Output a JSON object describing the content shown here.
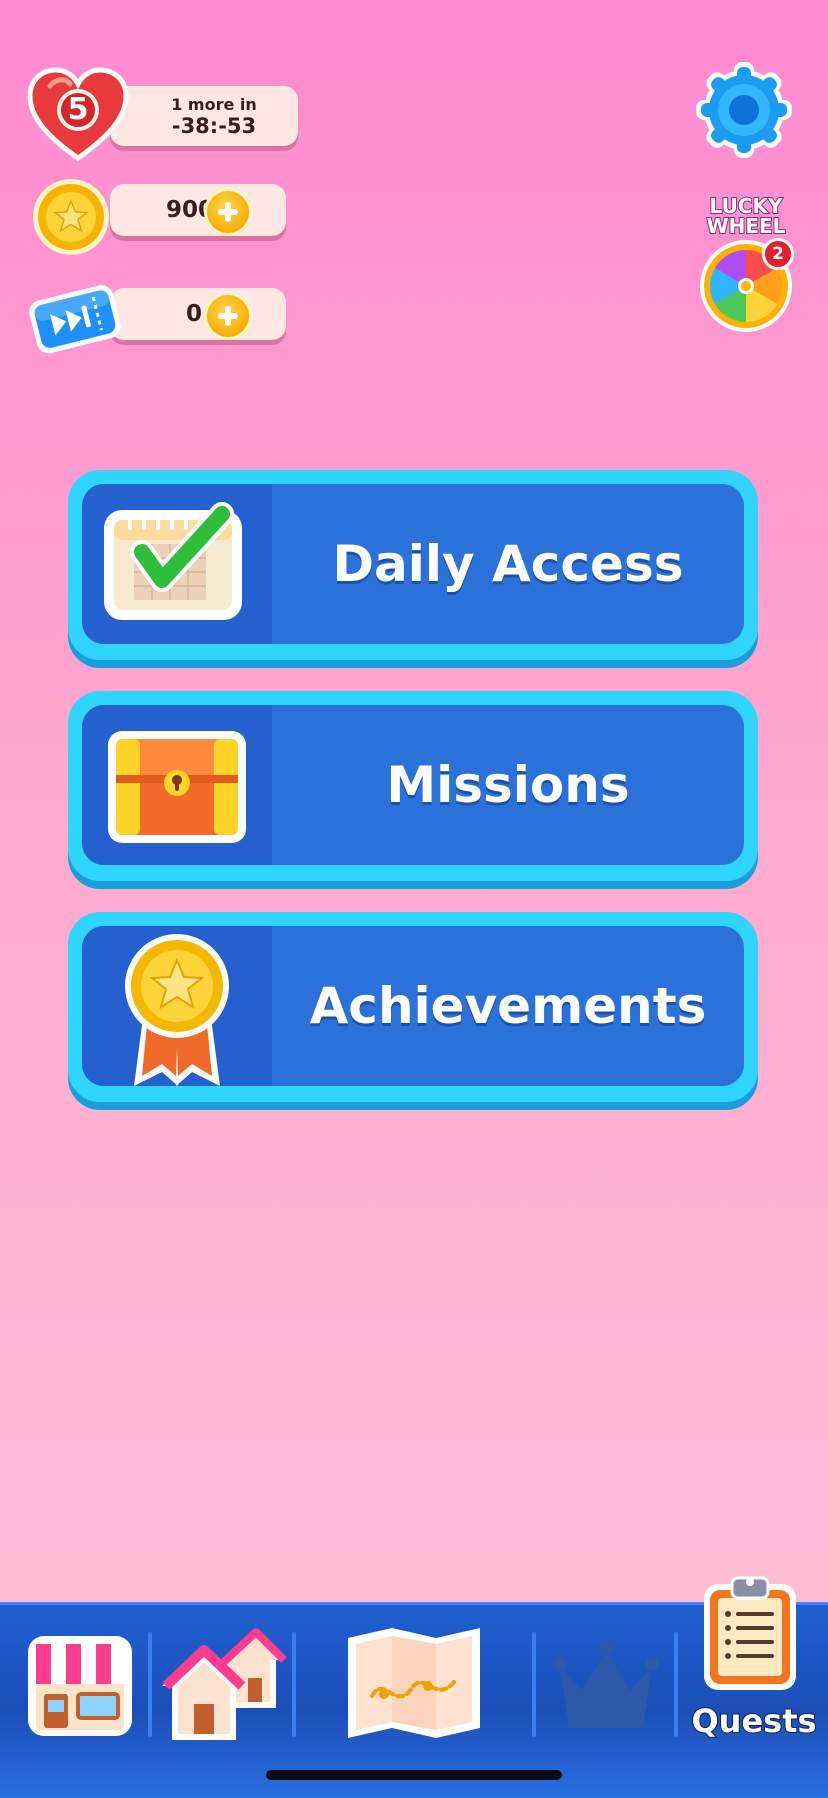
{
  "hud": {
    "lives": {
      "count": "5",
      "timer_label": "1 more in",
      "timer_value": "-38:-53"
    },
    "coins": {
      "value": "900"
    },
    "skips": {
      "value": "0"
    }
  },
  "settings": {
    "icon": "gear-icon"
  },
  "lucky_wheel": {
    "title_line1": "LUCKY",
    "title_line2": "WHEEL",
    "badge": "2"
  },
  "menu": [
    {
      "label": "Daily Access",
      "icon": "calendar-check-icon"
    },
    {
      "label": "Missions",
      "icon": "treasure-chest-icon"
    },
    {
      "label": "Achievements",
      "icon": "medal-icon"
    }
  ],
  "tabbar": {
    "tabs": [
      {
        "icon": "shop-icon"
      },
      {
        "icon": "houses-icon"
      },
      {
        "icon": "map-icon"
      },
      {
        "icon": "crown-icon"
      },
      {
        "icon": "clipboard-icon",
        "label": "Quests"
      }
    ]
  },
  "colors": {
    "background_top": "#ff8ad0",
    "background_bottom": "#ffc3d6",
    "card_border": "#2fd4ff",
    "card_fill": "#2a71d9",
    "tabbar": "#1f5fd0"
  }
}
